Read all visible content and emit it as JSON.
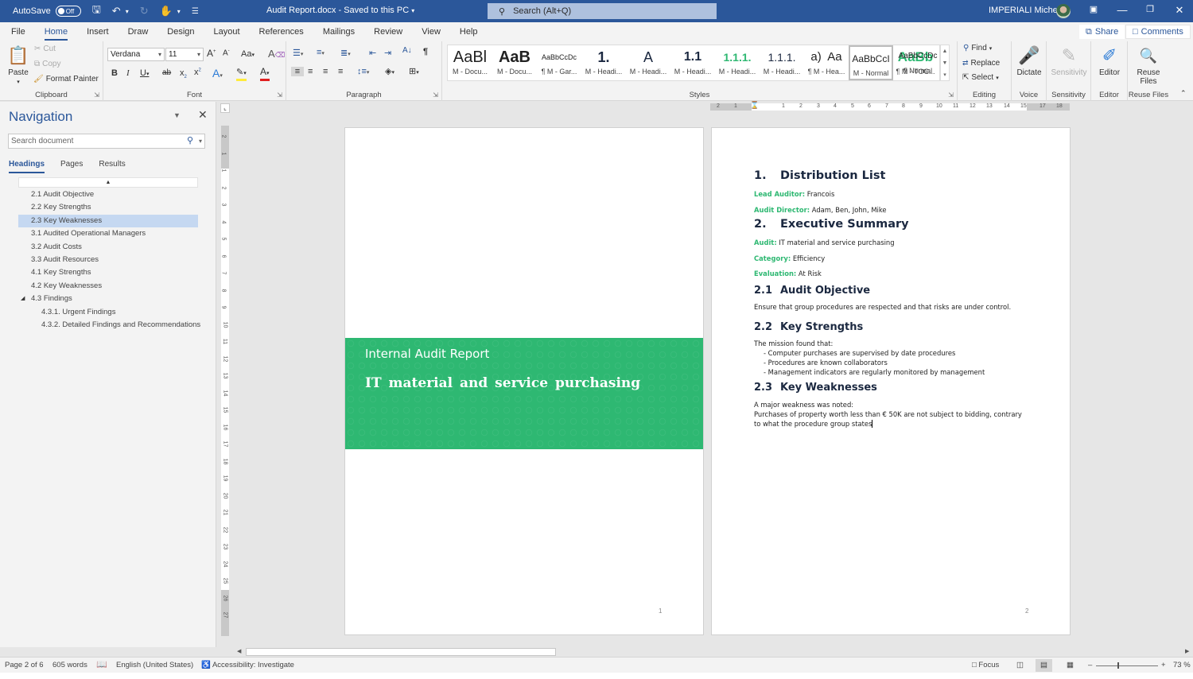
{
  "titlebar": {
    "autosave_label": "AutoSave",
    "autosave_state": "Off",
    "doc_title": "Audit Report.docx  -  Saved to this PC",
    "search_placeholder": "Search (Alt+Q)",
    "user_name": "IMPERIALI Michele",
    "icons": [
      "save-icon",
      "undo-icon",
      "redo-icon",
      "touch-mode-icon",
      "customize-qat-icon"
    ]
  },
  "menu": {
    "tabs": [
      "File",
      "Home",
      "Insert",
      "Draw",
      "Design",
      "Layout",
      "References",
      "Mailings",
      "Review",
      "View",
      "Help"
    ],
    "active": "Home",
    "share_label": "Share",
    "comments_label": "Comments"
  },
  "ribbon": {
    "clipboard": {
      "label": "Clipboard",
      "paste": "Paste",
      "cut": "Cut",
      "copy": "Copy",
      "format_painter": "Format Painter"
    },
    "font": {
      "label": "Font",
      "font_name": "Verdana",
      "font_size": "11",
      "change_case": "Aa"
    },
    "paragraph": {
      "label": "Paragraph"
    },
    "styles": {
      "label": "Styles",
      "items": [
        {
          "preview": "AaBl",
          "name": "M - Docu..."
        },
        {
          "preview": "AaB",
          "name": "M - Docu..."
        },
        {
          "preview": "AaBbCcDc",
          "name": "¶ M - Gar..."
        },
        {
          "preview": "1.",
          "name": "M - Headi..."
        },
        {
          "preview": "A",
          "name": "M - Headi..."
        },
        {
          "preview": "1.1",
          "name": "M - Headi..."
        },
        {
          "preview": "1.1.1.",
          "name": "M - Headi..."
        },
        {
          "preview": "1.1.1.",
          "name": "M - Headi..."
        },
        {
          "preview": "a)",
          "name": "¶ M - Hea..."
        },
        {
          "preview": "AaBbCcI",
          "name": "M - Normal"
        },
        {
          "preview": "AaBb",
          "name": "¶ M - TOC..."
        },
        {
          "preview": "AaBbCcDc",
          "name": "¶ Normal"
        }
      ],
      "selected": "M - Normal"
    },
    "editing": {
      "label": "Editing",
      "find": "Find",
      "replace": "Replace",
      "select": "Select"
    },
    "voice": {
      "label": "Voice",
      "dictate": "Dictate"
    },
    "sensitivity": {
      "label": "Sensitivity",
      "button": "Sensitivity"
    },
    "editor": {
      "label": "Editor",
      "button": "Editor"
    },
    "reuse": {
      "label": "Reuse Files",
      "button_line1": "Reuse",
      "button_line2": "Files"
    }
  },
  "navigation": {
    "title": "Navigation",
    "search_placeholder": "Search document",
    "tabs": [
      "Headings",
      "Pages",
      "Results"
    ],
    "active_tab": "Headings",
    "headings": [
      {
        "text": "2.1 Audit Objective",
        "level": 1
      },
      {
        "text": "2.2 Key Strengths",
        "level": 1
      },
      {
        "text": "2.3 Key Weaknesses",
        "level": 1,
        "selected": true
      },
      {
        "text": "3.1 Audited Operational Managers",
        "level": 1
      },
      {
        "text": "3.2 Audit Costs",
        "level": 1
      },
      {
        "text": "3.3 Audit Resources",
        "level": 1
      },
      {
        "text": "4.1 Key Strengths",
        "level": 1
      },
      {
        "text": "4.2 Key Weaknesses",
        "level": 1
      },
      {
        "text": "4.3 Findings",
        "level": 1,
        "expanded": true
      },
      {
        "text": "4.3.1. Urgent Findings",
        "level": 2
      },
      {
        "text": "4.3.2. Detailed Findings and Recommendations",
        "level": 2
      }
    ]
  },
  "rulers": {
    "horizontal": [
      "2",
      "1",
      "1",
      "2",
      "3",
      "4",
      "5",
      "6",
      "7",
      "8",
      "9",
      "10",
      "11",
      "12",
      "13",
      "14",
      "15",
      "17",
      "18"
    ],
    "vertical": [
      "2",
      "1",
      "1",
      "2",
      "3",
      "4",
      "5",
      "6",
      "7",
      "8",
      "9",
      "10",
      "11",
      "12",
      "13",
      "14",
      "15",
      "16",
      "17",
      "18",
      "19",
      "20",
      "21",
      "22",
      "23",
      "24",
      "25",
      "26",
      "27"
    ]
  },
  "page1": {
    "cover_subtitle": "Internal Audit Report",
    "cover_title": "IT material and service purchasing",
    "page_number": "1"
  },
  "page2": {
    "page_number": "2",
    "sec1": {
      "num": "1.",
      "title": "Distribution List"
    },
    "lead_auditor": {
      "k": "Lead Auditor:",
      "v": " Francois"
    },
    "audit_director": {
      "k": "Audit Director:",
      "v": " Adam, Ben, John, Mike"
    },
    "sec2": {
      "num": "2.",
      "title": "Executive Summary"
    },
    "audit": {
      "k": "Audit:",
      "v": " IT material and service purchasing"
    },
    "category": {
      "k": "Category:",
      "v": " Efficiency"
    },
    "evaluation": {
      "k": "Evaluation:",
      "v": " At Risk"
    },
    "sec21": {
      "num": "2.1",
      "title": "Audit Objective"
    },
    "objective_text": "Ensure that group procedures are respected and that risks are under control.",
    "sec22": {
      "num": "2.2",
      "title": "Key Strengths"
    },
    "strengths_intro": "The mission found that:",
    "strengths": [
      "- Computer purchases are supervised by date procedures",
      "- Procedures are known collaborators",
      "- Management indicators are regularly monitored by management"
    ],
    "sec23": {
      "num": "2.3",
      "title": "Key Weaknesses"
    },
    "weakness_intro": "A major weakness was noted:",
    "weakness_line1": "Purchases of property worth less than € 50K are not subject to bidding, contrary",
    "weakness_line2": "to what the procedure group states"
  },
  "statusbar": {
    "page": "Page 2 of 6",
    "words": "605 words",
    "language": "English (United States)",
    "accessibility": "Accessibility: Investigate",
    "focus": "Focus",
    "zoom": "73 %",
    "zoom_percent": 73
  },
  "colors": {
    "titlebar": "#2b579a",
    "accent_green": "#2eb872",
    "heading_navy": "#1b2840",
    "nav_selected": "#c5d8f1"
  }
}
